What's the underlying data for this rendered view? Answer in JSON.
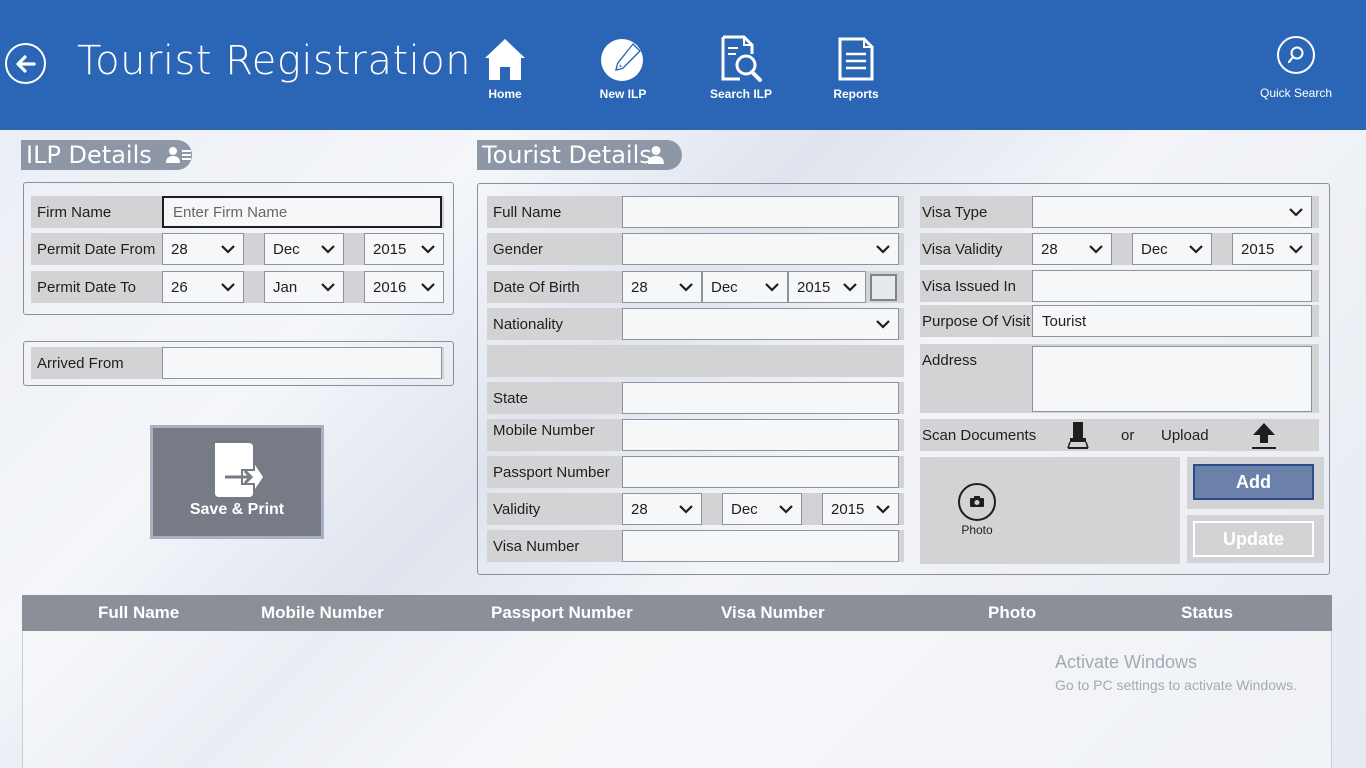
{
  "header": {
    "title": "Tourist Registration",
    "nav": [
      {
        "label": "Home",
        "icon": "home-icon"
      },
      {
        "label": "New ILP",
        "icon": "edit-icon"
      },
      {
        "label": "Search ILP",
        "icon": "search-document-icon"
      },
      {
        "label": "Reports",
        "icon": "reports-icon"
      }
    ],
    "quick_search": "Quick Search"
  },
  "ilp": {
    "section_title": "ILP Details",
    "firm_name": {
      "label": "Firm Name",
      "placeholder": "Enter Firm Name"
    },
    "permit_from": {
      "label": "Permit Date From",
      "day": "28",
      "month": "Dec",
      "year": "2015"
    },
    "permit_to": {
      "label": "Permit Date To",
      "day": "26",
      "month": "Jan",
      "year": "2016"
    },
    "arrived_from": {
      "label": "Arrived From",
      "value": ""
    },
    "save_print": "Save & Print"
  },
  "tourist": {
    "section_title": "Tourist Details",
    "full_name": {
      "label": "Full Name",
      "value": ""
    },
    "gender": {
      "label": "Gender",
      "value": ""
    },
    "dob": {
      "label": "Date Of Birth",
      "day": "28",
      "month": "Dec",
      "year": "2015"
    },
    "nationality": {
      "label": "Nationality",
      "value": ""
    },
    "state": {
      "label": "State",
      "value": ""
    },
    "mobile": {
      "label": "Mobile Number",
      "value": ""
    },
    "passport": {
      "label": "Passport Number",
      "value": ""
    },
    "validity": {
      "label": "Validity",
      "day": "28",
      "month": "Dec",
      "year": "2015"
    },
    "visa_number": {
      "label": "Visa Number",
      "value": ""
    },
    "visa_type": {
      "label": "Visa Type",
      "value": ""
    },
    "visa_validity": {
      "label": "Visa Validity",
      "day": "28",
      "month": "Dec",
      "year": "2015"
    },
    "visa_issued_in": {
      "label": "Visa Issued In",
      "value": ""
    },
    "purpose": {
      "label": "Purpose Of Visit",
      "value": "Tourist"
    },
    "address": {
      "label": "Address",
      "value": ""
    },
    "scan": {
      "label": "Scan Documents",
      "or": "or",
      "upload": "Upload"
    },
    "photo": "Photo",
    "add": "Add",
    "update": "Update"
  },
  "table": {
    "columns": [
      "Full Name",
      "Mobile Number",
      "Passport Number",
      "Visa Number",
      "Photo",
      "Status"
    ]
  },
  "watermark": {
    "title": "Activate Windows",
    "subtitle": "Go to PC settings to activate Windows."
  },
  "colors": {
    "header": "#2a66b5",
    "section_pill": "#8e97a6",
    "row_bg": "#d3d3d5",
    "add_button": "#6c81a9",
    "table_header": "#8a8f98"
  }
}
